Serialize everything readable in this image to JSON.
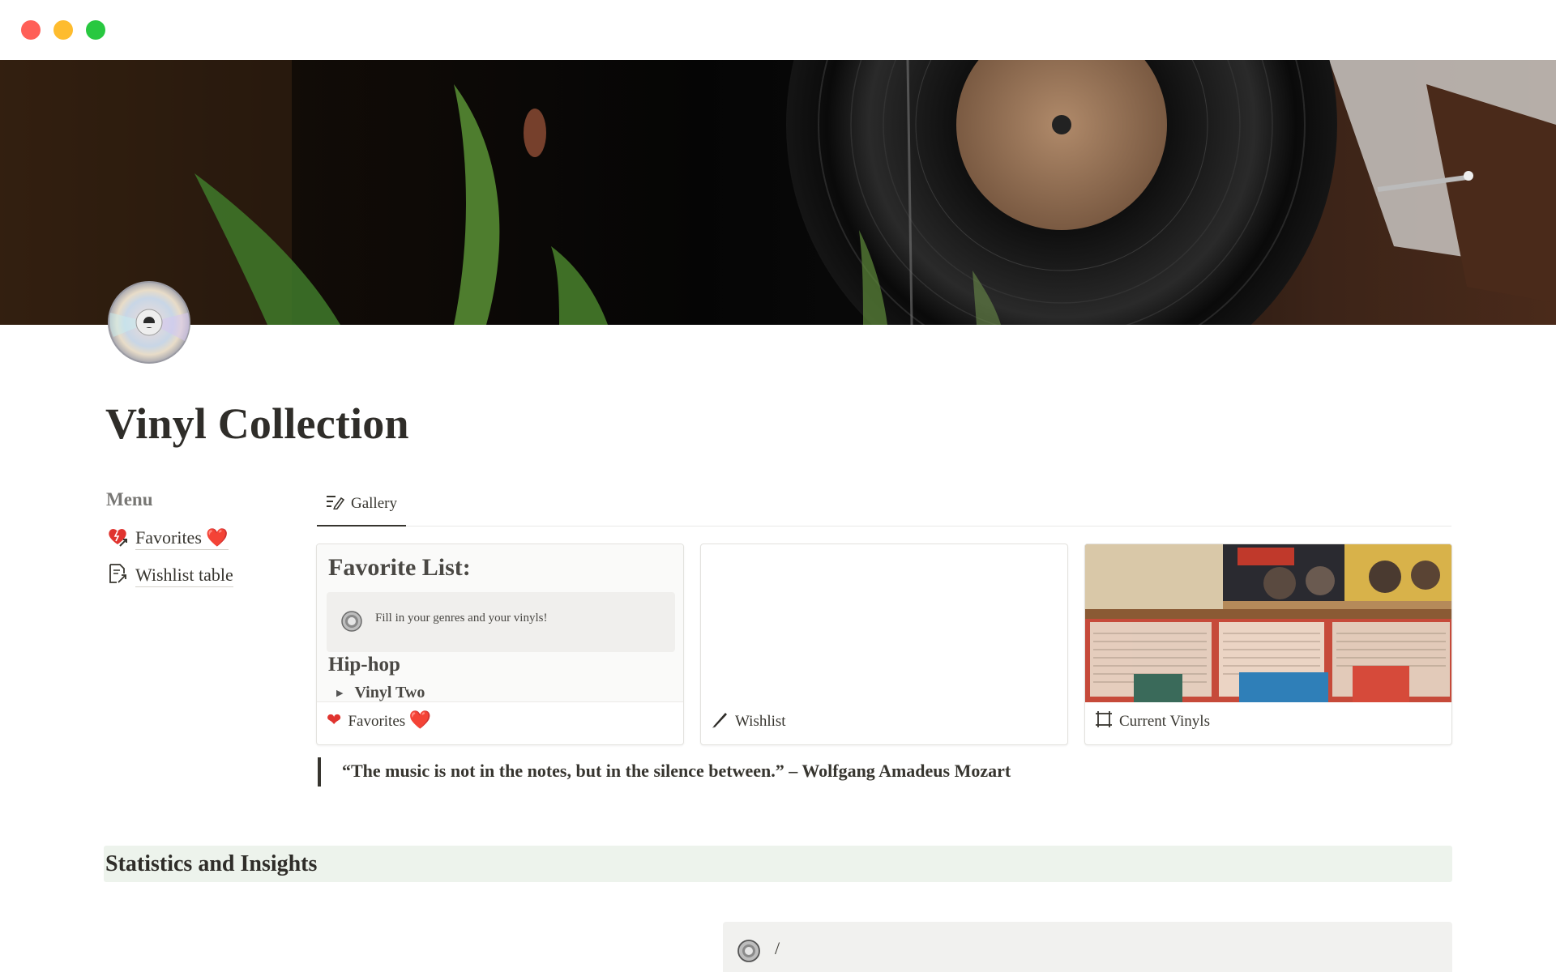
{
  "page": {
    "title": "Vinyl Collection",
    "icon": "cd-disc-icon"
  },
  "menu": {
    "heading": "Menu",
    "items": [
      {
        "label": "Favorites",
        "icon": "heart-arrow-icon",
        "suffix": "❤️"
      },
      {
        "label": "Wishlist table",
        "icon": "page-link-icon"
      }
    ]
  },
  "gallery": {
    "tab_label": "Gallery",
    "cards": [
      {
        "title": "Favorites",
        "suffix": "❤️",
        "icon": "heart-icon",
        "preview": {
          "heading": "Favorite List:",
          "callout": "Fill in your genres and your vinyls!",
          "genre": "Hip-hop",
          "toggle": "Vinyl Two"
        }
      },
      {
        "title": "Wishlist",
        "icon": "pen-icon"
      },
      {
        "title": "Current Vinyls",
        "icon": "frame-icon"
      }
    ]
  },
  "quote": "“The music is not in the notes, but in the silence between.” – Wolfgang Amadeus Mozart",
  "statistics": {
    "heading": "Statistics and Insights"
  },
  "bottom_callout": {
    "text": "/"
  },
  "colors": {
    "accent_heart": "#e0342f",
    "stats_bg": "#edf3ec",
    "text": "#37352f"
  }
}
